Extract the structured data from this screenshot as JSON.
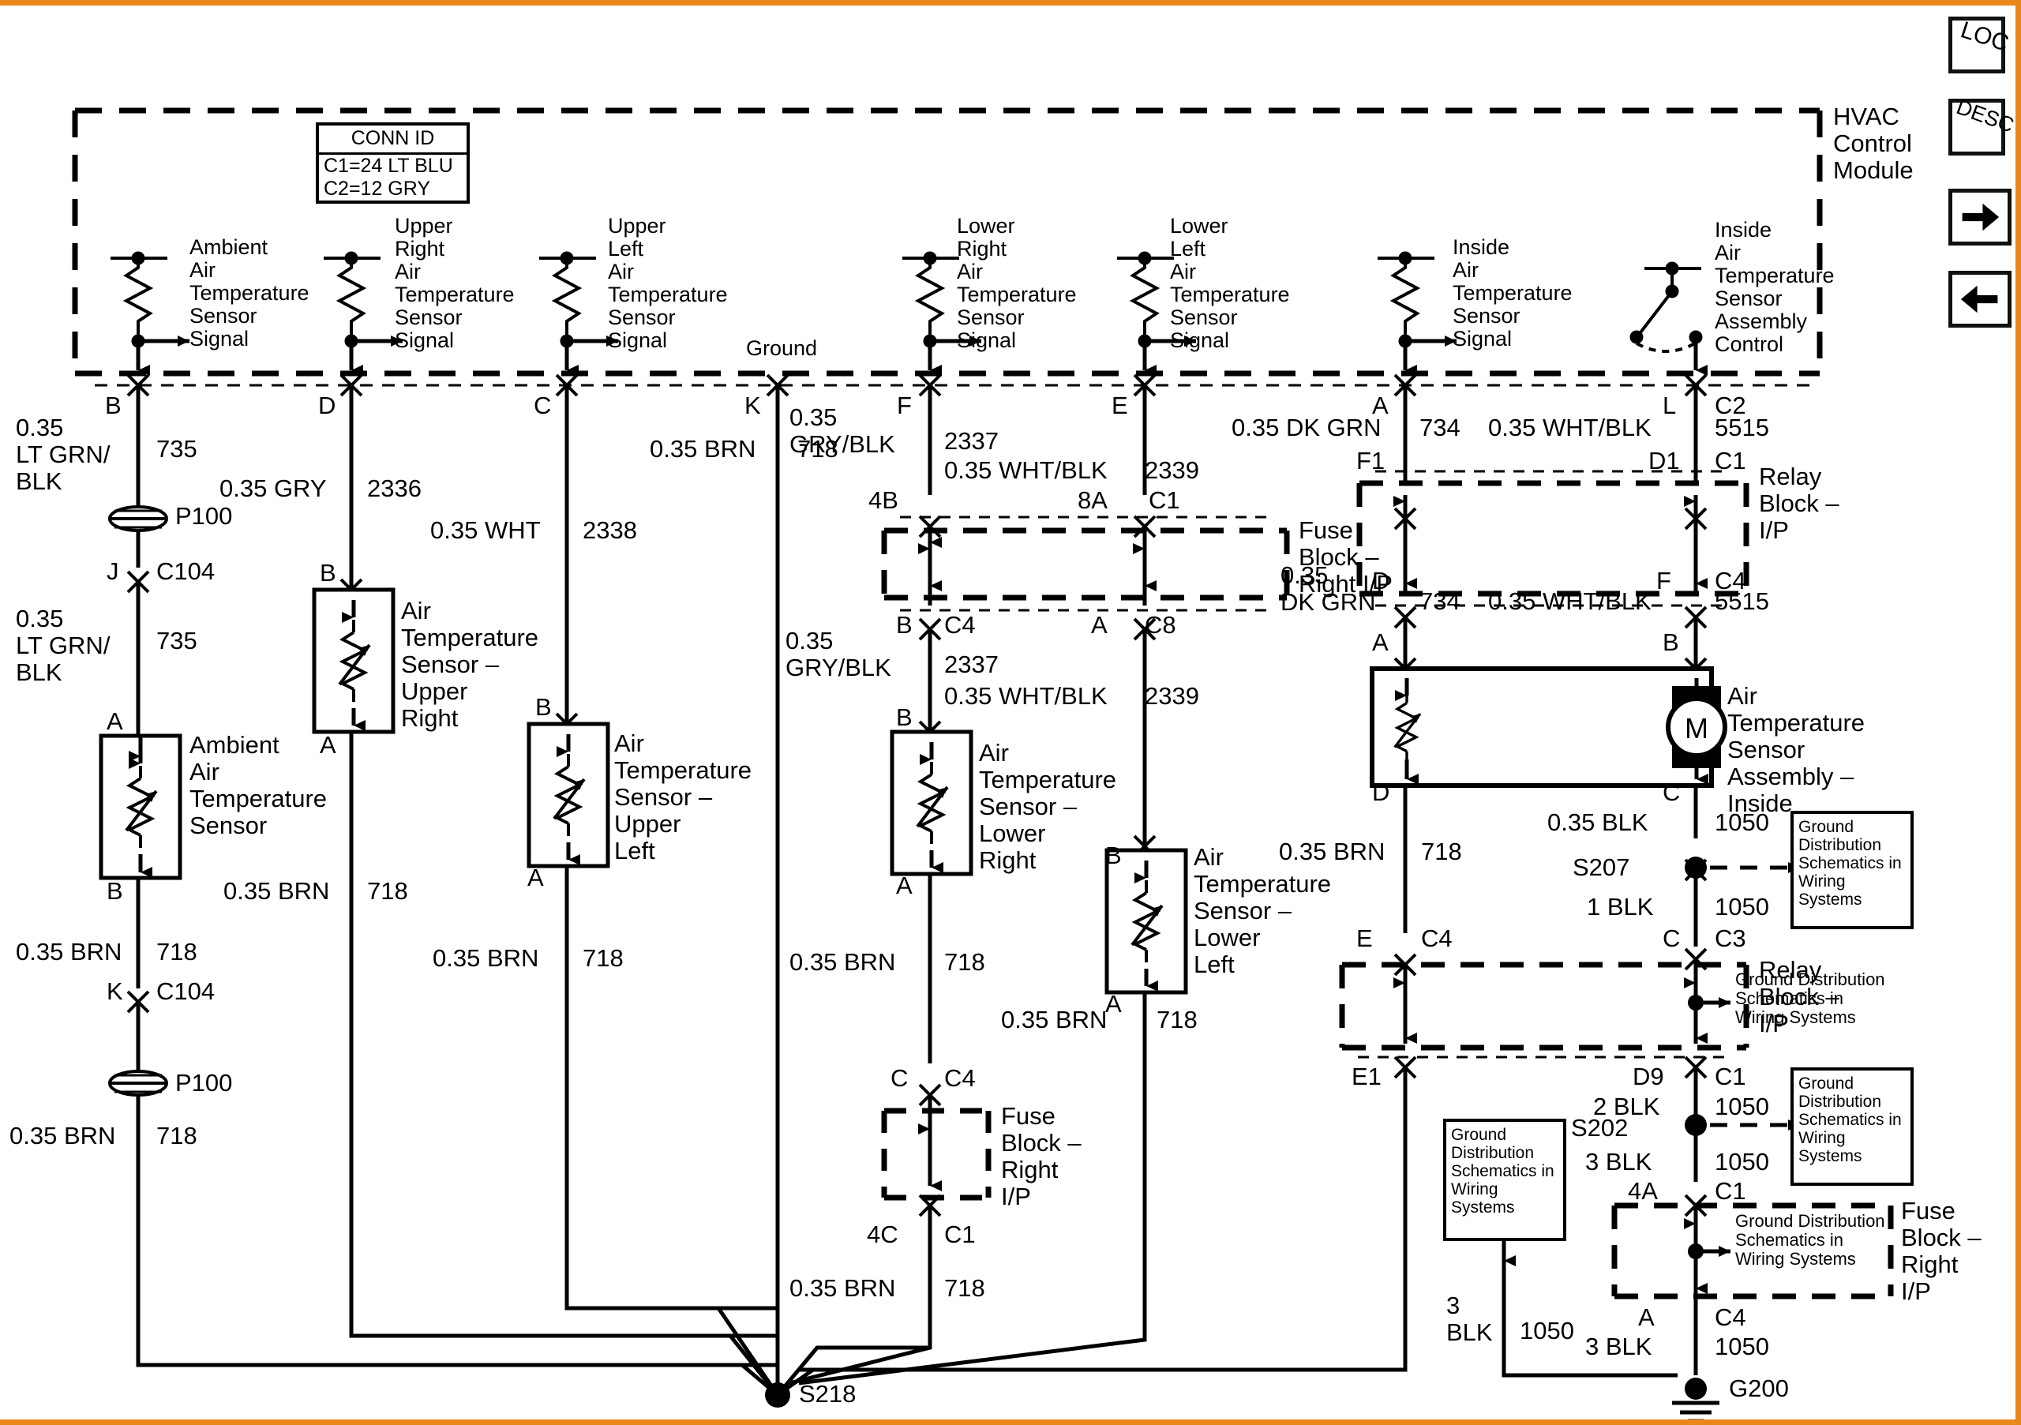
{
  "diagram": {
    "title": "HVAC Control Module air temperature sensor wiring schematic",
    "module_label": "HVAC\nControl\nModule",
    "conn_id": {
      "header": "CONN ID",
      "rows": [
        "C1=24 LT BLU",
        "C2=12 GRY"
      ]
    },
    "ground_pin_label": "Ground"
  },
  "nav_buttons": [
    {
      "name": "loc-button",
      "label": "LOC",
      "style": "diagonal-text"
    },
    {
      "name": "desc-button",
      "label": "DESC",
      "style": "diagonal-text"
    },
    {
      "name": "next-button",
      "label": "→",
      "style": "arrow-right"
    },
    {
      "name": "previous-button",
      "label": "←",
      "style": "arrow-left"
    }
  ],
  "module_inputs": [
    {
      "name": "ambient",
      "text": "Ambient\nAir\nTemperature\nSensor\nSignal",
      "pin": "B"
    },
    {
      "name": "upper-right",
      "text": "Upper\nRight\nAir\nTemperature\nSensor\nSignal",
      "pin": "D"
    },
    {
      "name": "upper-left",
      "text": "Upper\nLeft\nAir\nTemperature\nSensor\nSignal",
      "pin": "C"
    },
    {
      "name": "ground",
      "text": "Ground",
      "pin": "K"
    },
    {
      "name": "lower-right",
      "text": "Lower\nRight\nAir\nTemperature\nSensor\nSignal",
      "pin": "F"
    },
    {
      "name": "lower-left",
      "text": "Lower\nLeft\nAir\nTemperature\nSensor\nSignal",
      "pin": "E"
    },
    {
      "name": "inside",
      "text": "Inside\nAir\nTemperature\nSensor\nSignal",
      "pin": "A"
    },
    {
      "name": "inside-assembly-control",
      "text": "Inside\nAir\nTemperature\nSensor\nAssembly\nControl",
      "pin": "L"
    }
  ],
  "wire_labels": {
    "w1": "0.35\nLT GRN/\nBLK",
    "n1": "735",
    "w2": "0.35 GRY",
    "n2": "2336",
    "w3": "0.35 WHT",
    "n3": "2338",
    "w4": "0.35 BRN",
    "n4": "718",
    "w5": "0.35\nGRY/BLK",
    "n5": "2337",
    "w6": "0.35 WHT/BLK",
    "n6": "2339",
    "w7": "0.35 DK GRN",
    "n7": "734",
    "w8": "0.35 WHT/BLK",
    "n8": "5515",
    "w9": "0.35\nLT GRN/\nBLK",
    "n9": "735",
    "w10": "0.35\nGRY/BLK",
    "n10": "2337",
    "w11": "0.35 WHT/BLK",
    "n11": "2339",
    "w12": "0.35\nDK GRN",
    "n12": "734",
    "w13": "0.35 WHT/BLK",
    "n13": "5515",
    "w14": "0.35 BRN",
    "n14": "718",
    "w15": "0.35 BRN",
    "n15": "718",
    "w16": "0.35 BRN",
    "n16": "718",
    "w17": "0.35 BRN",
    "n17": "718",
    "w18": "0.35 BRN",
    "n18": "718",
    "w19": "0.35 BRN",
    "n19": "718",
    "w20": "0.35 BRN",
    "n20": "718",
    "w21": "0.35 BRN",
    "n21": "718",
    "w22": "0.35 BLK",
    "n22": "1050",
    "w23": "1 BLK",
    "n23": "1050",
    "w24": "2 BLK",
    "n24": "1050",
    "w25": "3 BLK",
    "n25": "1050",
    "w26": "3 BLK",
    "n26": "1050",
    "w27": "3\nBLK",
    "n27": "1050"
  },
  "pins": {
    "p_B1": "B",
    "p_D1": "D",
    "p_C1": "C",
    "p_K1": "K",
    "p_F1": "F",
    "p_E1": "E",
    "p_A1": "A",
    "p_L1": "L",
    "p_C2": "C2",
    "p_C1c": "C1",
    "p_F1b": "F1",
    "p_D1b": "D1",
    "p_J": "J",
    "p_C104a": "C104",
    "p_A2": "A",
    "p_B2": "B",
    "p_K2": "K",
    "p_C104b": "C104",
    "p_B3": "B",
    "p_A3": "A",
    "p_B4": "B",
    "p_A4": "A",
    "p_4B": "4B",
    "p_8A": "8A",
    "p_C1d": "C1",
    "p_Bc4": "B",
    "p_C4a": "C4",
    "p_Ac8": "A",
    "p_C8": "C8",
    "p_B5": "B",
    "p_A5": "A",
    "p_B6": "B",
    "p_A6": "A",
    "p_C7": "C",
    "p_C4b": "C4",
    "p_4C": "4C",
    "p_C1e": "C1",
    "p_D2": "D",
    "p_F2": "F",
    "p_C4c": "C4",
    "p_A7": "A",
    "p_B7": "B",
    "p_D3": "D",
    "p_C3": "C",
    "p_S207": "S207",
    "p_C8b": "C",
    "p_C3b": "C3",
    "p_E2": "E",
    "p_C4d": "C4",
    "p_E1b": "E1",
    "p_D9": "D9",
    "p_C1f": "C1",
    "p_S202": "S202",
    "p_4A": "4A",
    "p_C1g": "C1",
    "p_Ac4": "A",
    "p_C4e": "C4"
  },
  "components": {
    "p100_a": "P100",
    "p100_b": "P100",
    "sensor_ambient": "Ambient\nAir\nTemperature\nSensor",
    "sensor_upper_right": "Air\nTemperature\nSensor –\nUpper\nRight",
    "sensor_upper_left": "Air\nTemperature\nSensor –\nUpper\nLeft",
    "sensor_lower_right": "Air\nTemperature\nSensor –\nLower\nRight",
    "sensor_lower_left": "Air\nTemperature\nSensor –\nLower\nLeft",
    "sensor_assembly_inside": "Air\nTemperature\nSensor\nAssembly –\nInside",
    "motor_symbol": "M",
    "splice_s218": "S218",
    "ground_g200": "G200"
  },
  "blocks": {
    "fuse_block_right_ip_1": "Fuse\nBlock –\nRight I/P",
    "fuse_block_right_ip_2": "Fuse\nBlock –\nRight\nI/P",
    "fuse_block_right_ip_3": "Fuse\nBlock –\nRight\nI/P",
    "relay_block_ip_1": "Relay\nBlock –\nI/P",
    "relay_block_ip_2": "Relay\nBlock –\nI/P"
  },
  "reference_boxes": {
    "gd_box_1": "Ground\nDistribution\nSchematics\nin Wiring\nSystems",
    "gd_box_2": "Ground\nDistribution\nSchematics\nin Wiring\nSystems",
    "gd_box_3": "Ground\nDistribution\nSchematics\nin Wiring\nSystems",
    "gd_inline_1": "Ground Distribution\nSchematics in\nWiring Systems",
    "gd_inline_2": "Ground Distribution\nSchematics in\nWiring Systems"
  },
  "colors": {
    "ink": "#000000",
    "page": "#ffffff",
    "frame_accent": "#e8871a"
  }
}
